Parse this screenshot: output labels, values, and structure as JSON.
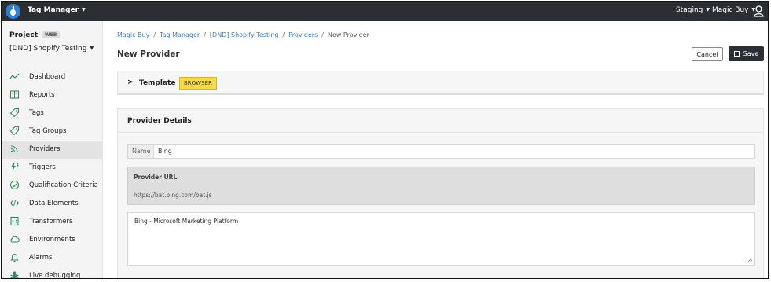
{
  "topbar": {
    "app_name": "Tag Manager",
    "environment": "Staging",
    "organization": "Magic Buy"
  },
  "sidebar": {
    "project_label": "Project",
    "project_badge": "WEB",
    "project_name": "[DND] Shopify Testing",
    "items": [
      {
        "label": "Dashboard",
        "icon": "line-chart-icon"
      },
      {
        "label": "Reports",
        "icon": "book-icon"
      },
      {
        "label": "Tags",
        "icon": "tag-icon"
      },
      {
        "label": "Tag Groups",
        "icon": "tag-icon"
      },
      {
        "label": "Providers",
        "icon": "rss-icon",
        "active": true
      },
      {
        "label": "Triggers",
        "icon": "lightning-icon"
      },
      {
        "label": "Qualification Criteria",
        "icon": "check-circle-icon"
      },
      {
        "label": "Data Elements",
        "icon": "code-icon"
      },
      {
        "label": "Transformers",
        "icon": "document-code-icon"
      },
      {
        "label": "Environments",
        "icon": "cloud-icon"
      },
      {
        "label": "Alarms",
        "icon": "bell-icon"
      },
      {
        "label": "Live debugging",
        "icon": "bug-icon"
      }
    ]
  },
  "breadcrumb": {
    "items": [
      "Magic Buy",
      "Tag Manager",
      "[DND] Shopify Testing",
      "Providers"
    ],
    "current": "New Provider"
  },
  "page": {
    "title": "New Provider",
    "cancel_label": "Cancel",
    "save_label": "Save"
  },
  "template_panel": {
    "label": "Template",
    "badge": "BROWSER"
  },
  "details": {
    "title": "Provider Details",
    "name_label": "Name",
    "name_value": "Bing",
    "url_label": "Provider URL",
    "url_value": "https://bat.bing.com/bat.js",
    "description": "Bing - Microsoft Marketing Platform"
  },
  "colors": {
    "topbar_bg": "#2b2f33",
    "link": "#2f7fd6",
    "icon_accent": "#2f8f5b",
    "badge_yellow": "#f7d94c"
  }
}
